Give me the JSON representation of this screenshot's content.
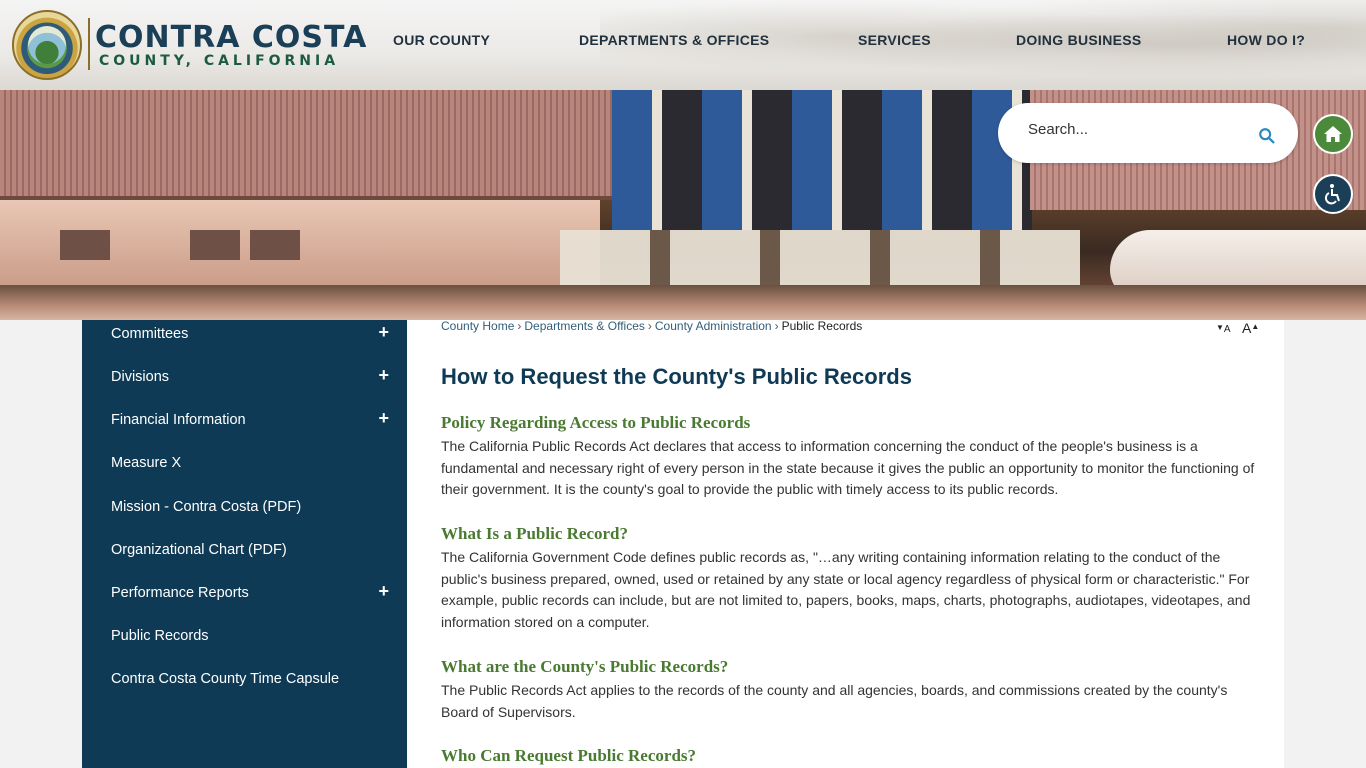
{
  "brand": {
    "title": "CONTRA COSTA",
    "subtitle": "COUNTY, CALIFORNIA"
  },
  "nav": [
    {
      "label": "OUR COUNTY"
    },
    {
      "label": "DEPARTMENTS & OFFICES"
    },
    {
      "label": "SERVICES"
    },
    {
      "label": "DOING BUSINESS"
    },
    {
      "label": "HOW DO I?"
    }
  ],
  "search": {
    "placeholder": "Search..."
  },
  "sidebar": {
    "items": [
      {
        "label": "Committees",
        "expandable": "+"
      },
      {
        "label": "Divisions",
        "expandable": "+"
      },
      {
        "label": "Financial Information",
        "expandable": "+"
      },
      {
        "label": "Measure X",
        "expandable": ""
      },
      {
        "label": "Mission - Contra Costa (PDF)",
        "expandable": ""
      },
      {
        "label": "Organizational Chart (PDF)",
        "expandable": ""
      },
      {
        "label": "Performance Reports",
        "expandable": "+"
      },
      {
        "label": "Public Records",
        "expandable": ""
      },
      {
        "label": "Contra Costa County Time Capsule",
        "expandable": ""
      }
    ]
  },
  "breadcrumb": {
    "items": [
      "County Home",
      "Departments & Offices",
      "County Administration"
    ],
    "separator": "›",
    "current": "Public Records"
  },
  "font_controls": {
    "decrease": "A",
    "increase": "A"
  },
  "page": {
    "title": "How to Request the County's Public Records",
    "sections": [
      {
        "heading": "Policy Regarding Access to Public Records",
        "body": "The California Public Records Act declares that access to information concerning the conduct of the people's business is a fundamental and necessary right of every person in the state because it gives the public an opportunity to monitor the functioning of their government. It is the county's goal to provide the public with timely access to its public records."
      },
      {
        "heading": "What Is a Public Record?",
        "body": "The California Government Code defines public records as, \"…any writing containing information relating to the conduct of the public's business prepared, owned, used or retained by any state or local agency regardless of physical form or characteristic.\" For example, public records can include, but are not limited to, papers, books, maps, charts, photographs, audiotapes, videotapes, and information stored on a computer."
      },
      {
        "heading": "What are the County's Public Records?",
        "body": "The Public Records Act applies to the records of the county and all agencies, boards, and commissions created by the county's Board of Supervisors."
      },
      {
        "heading": "Who Can Request Public Records?",
        "body": ""
      }
    ]
  },
  "colors": {
    "sidebar": "#0e3a55",
    "heading_green": "#4a7a32",
    "title_blue": "#0e3a55",
    "home_green": "#4a8a3a"
  }
}
